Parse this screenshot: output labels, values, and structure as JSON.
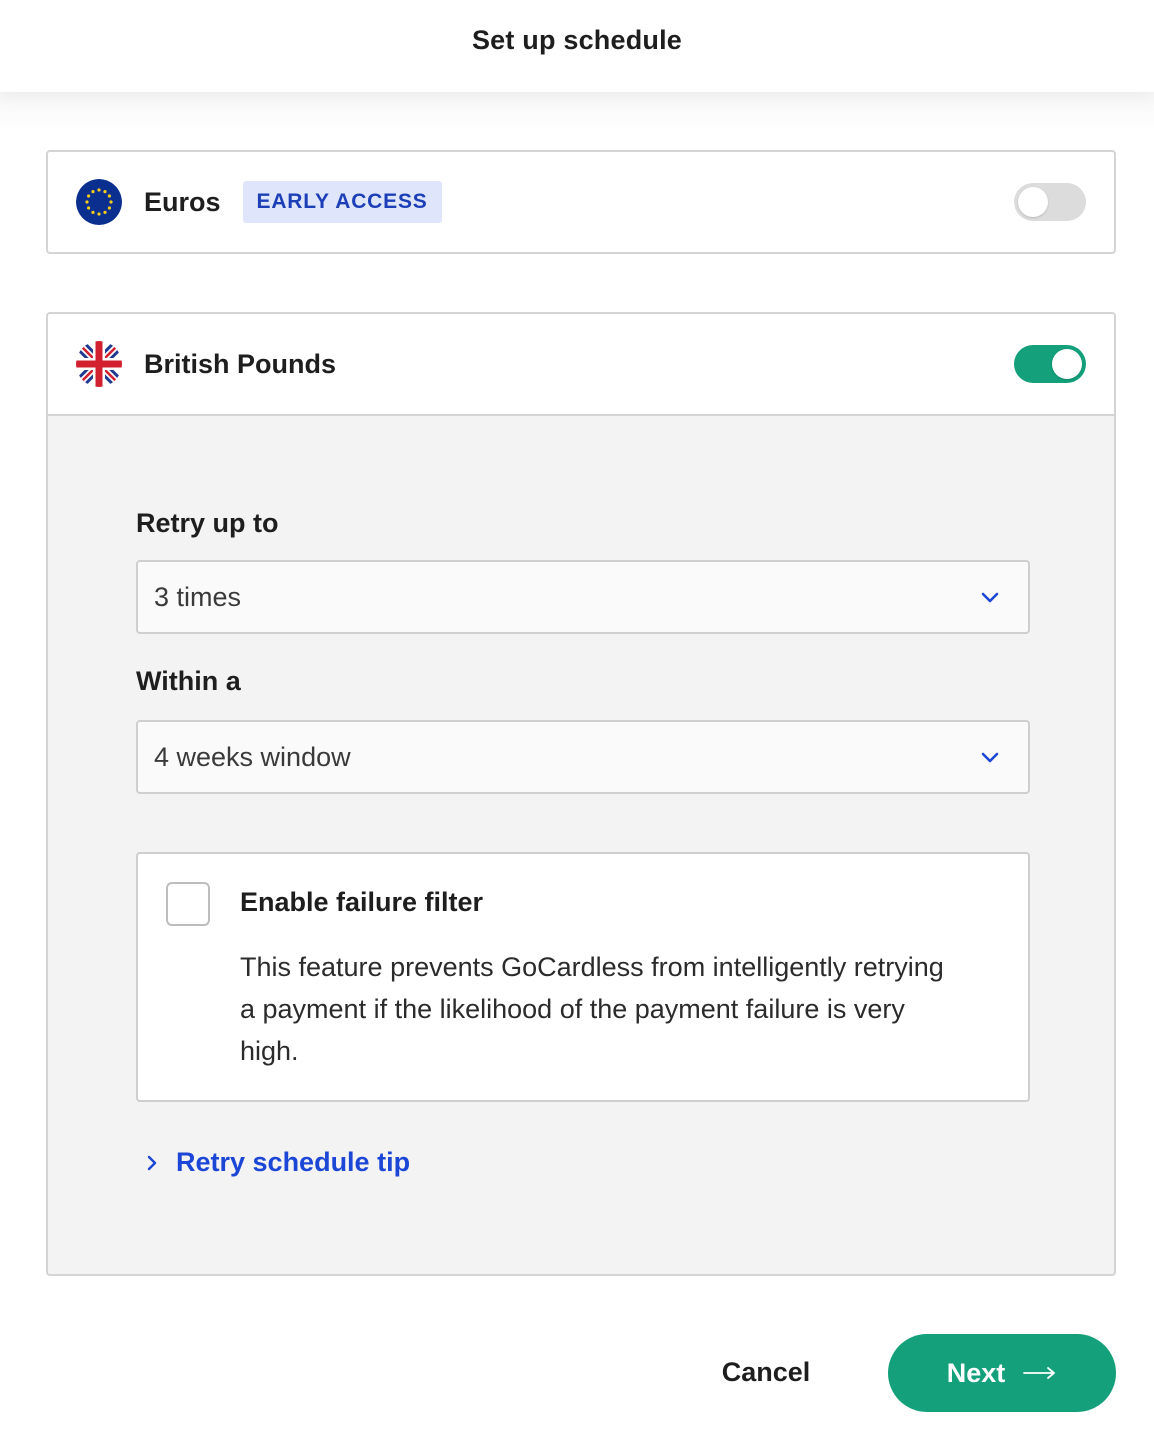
{
  "header": {
    "title": "Set up schedule"
  },
  "currencies": [
    {
      "label": "Euros",
      "badge": "EARLY ACCESS",
      "flag": "eu-flag-icon",
      "enabled": false
    },
    {
      "label": "British Pounds",
      "flag": "uk-flag-icon",
      "enabled": true
    }
  ],
  "form": {
    "retry_label": "Retry up to",
    "retry_value": "3 times",
    "window_label": "Within a",
    "window_value": "4 weeks window",
    "filter_title": "Enable failure filter",
    "filter_description": "This feature prevents GoCardless from intelligently retrying a payment if the likelihood of the payment failure is very high.",
    "filter_checked": false,
    "tip_link": "Retry schedule tip"
  },
  "footer": {
    "cancel_label": "Cancel",
    "next_label": "Next"
  },
  "colors": {
    "accent_green": "#13a07a",
    "link_blue": "#1c47d6",
    "badge_bg": "#dfe6fb"
  }
}
